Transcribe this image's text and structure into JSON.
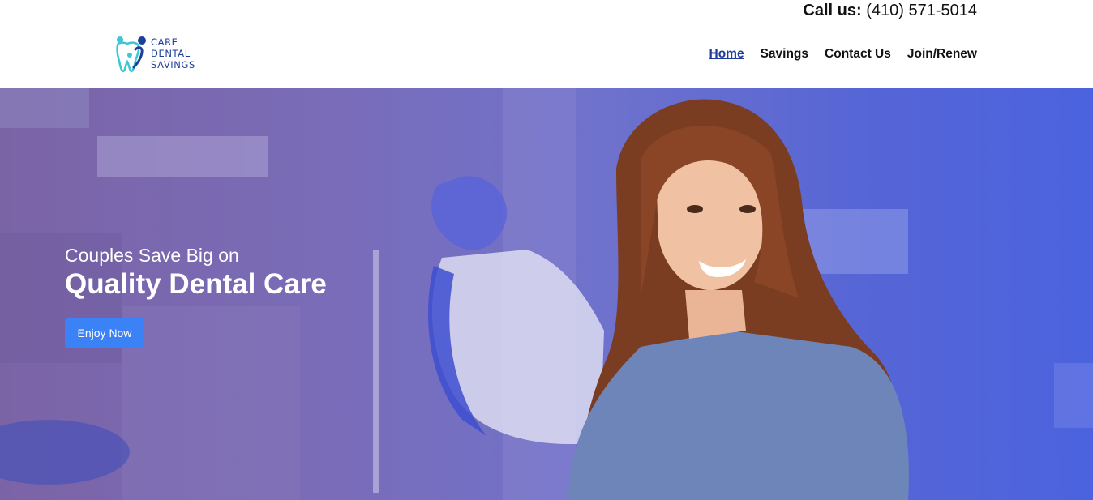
{
  "header": {
    "call_label": "Call us:",
    "call_number": "(410) 571-5014",
    "logo": {
      "line1": "CARE",
      "line2": "DENTAL",
      "line3": "SAVINGS",
      "icon": "tooth-family-icon"
    },
    "nav": [
      {
        "label": "Home",
        "active": true
      },
      {
        "label": "Savings",
        "active": false
      },
      {
        "label": "Contact Us",
        "active": false
      },
      {
        "label": "Join/Renew",
        "active": false
      }
    ]
  },
  "hero": {
    "subtitle": "Couples Save Big on",
    "title": "Quality Dental Care",
    "cta_label": "Enjoy Now",
    "image": "smiling-woman-in-dental-office-photo"
  },
  "colors": {
    "brand_blue": "#1d3f9c",
    "accent_teal": "#3cc6d6",
    "cta_blue": "#3b82f6",
    "hero_left": "#7b64a6",
    "hero_right": "#4c63df"
  }
}
